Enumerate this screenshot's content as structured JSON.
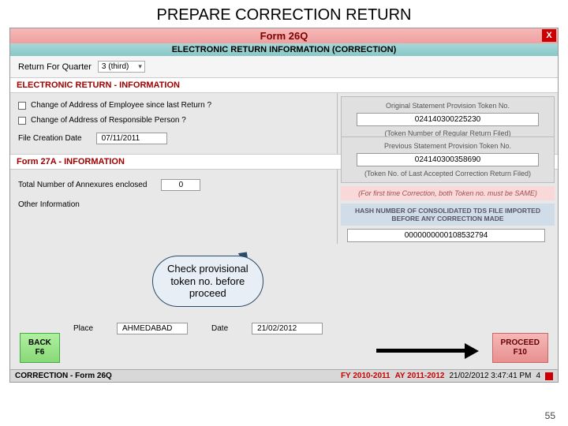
{
  "slide": {
    "title": "PREPARE CORRECTION RETURN",
    "page_num": "55"
  },
  "form": {
    "title": "Form 26Q",
    "subtitle": "ELECTRONIC RETURN INFORMATION (CORRECTION)",
    "close": "X",
    "quarter_label": "Return For Quarter",
    "quarter_value": "3 (third)"
  },
  "sections": {
    "eri": "ELECTRONIC RETURN - INFORMATION",
    "f27a": "Form 27A - INFORMATION"
  },
  "left": {
    "chk_emp": "Change of Address of Employee since last Return ?",
    "chk_resp": "Change of Address of Responsible Person ?",
    "file_date_label": "File Creation Date",
    "file_date_value": "07/11/2011",
    "annex_label": "Total Number of Annexures enclosed",
    "annex_value": "0",
    "other_label": "Other Information",
    "place_label": "Place",
    "place_value": "AHMEDABAD",
    "date_label": "Date",
    "date_value": "21/02/2012"
  },
  "right": {
    "orig_label": "Original Statement Provision Token No.",
    "orig_value": "024140300225230",
    "orig_note": "(Token Number of Regular Return Filed)",
    "prev_label": "Previous Statement Provision Token No.",
    "prev_value": "024140300358690",
    "prev_note": "(Token No. of Last Accepted Correction Return Filed)",
    "first_time_note": "(For first time Correction, both Token no. must be SAME)",
    "hash_label": "HASH NUMBER OF CONSOLIDATED TDS FILE IMPORTED  BEFORE ANY CORRECTION MADE",
    "hash_value": "0000000000108532794"
  },
  "callout": {
    "line1": "Check provisional",
    "line2": "token no. before",
    "line3": "proceed"
  },
  "buttons": {
    "back_l1": "BACK",
    "back_l2": "F6",
    "proceed_l1": "PROCEED",
    "proceed_l2": "F10"
  },
  "status": {
    "left": "CORRECTION - Form 26Q",
    "fy": "FY 2010-2011",
    "ay": "AY 2011-2012",
    "ts": "21/02/2012 3:47:41 PM",
    "num": "4"
  }
}
